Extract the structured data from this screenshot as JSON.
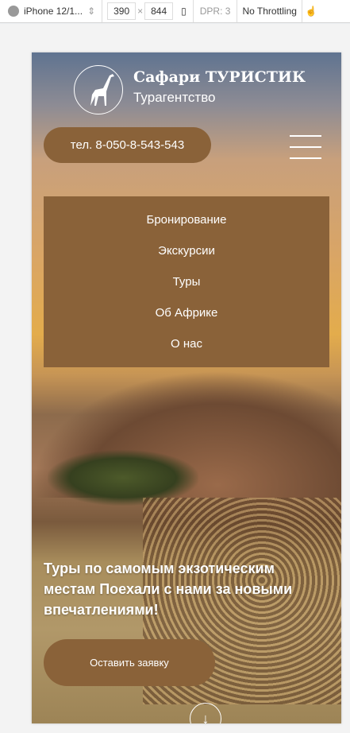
{
  "devtools": {
    "device": "iPhone 12/1...",
    "width": "390",
    "times": "×",
    "height": "844",
    "dpr": "DPR: 3",
    "throttling": "No Throttling"
  },
  "site": {
    "brand": "Сафари ТУРИСТИК",
    "subtitle": "Турагентство",
    "phone": "тел. 8-050-8-543-543",
    "menu": [
      "Бронирование",
      "Экскурсии",
      "Туры",
      "Об Африке",
      "О нас"
    ],
    "hero": "Туры по самомым экзотическим местам Поехали с нами за новыми впечатлениями!",
    "cta": "Оставить заявку",
    "down_arrow": "↓"
  },
  "colors": {
    "accent": "#8a6239"
  }
}
